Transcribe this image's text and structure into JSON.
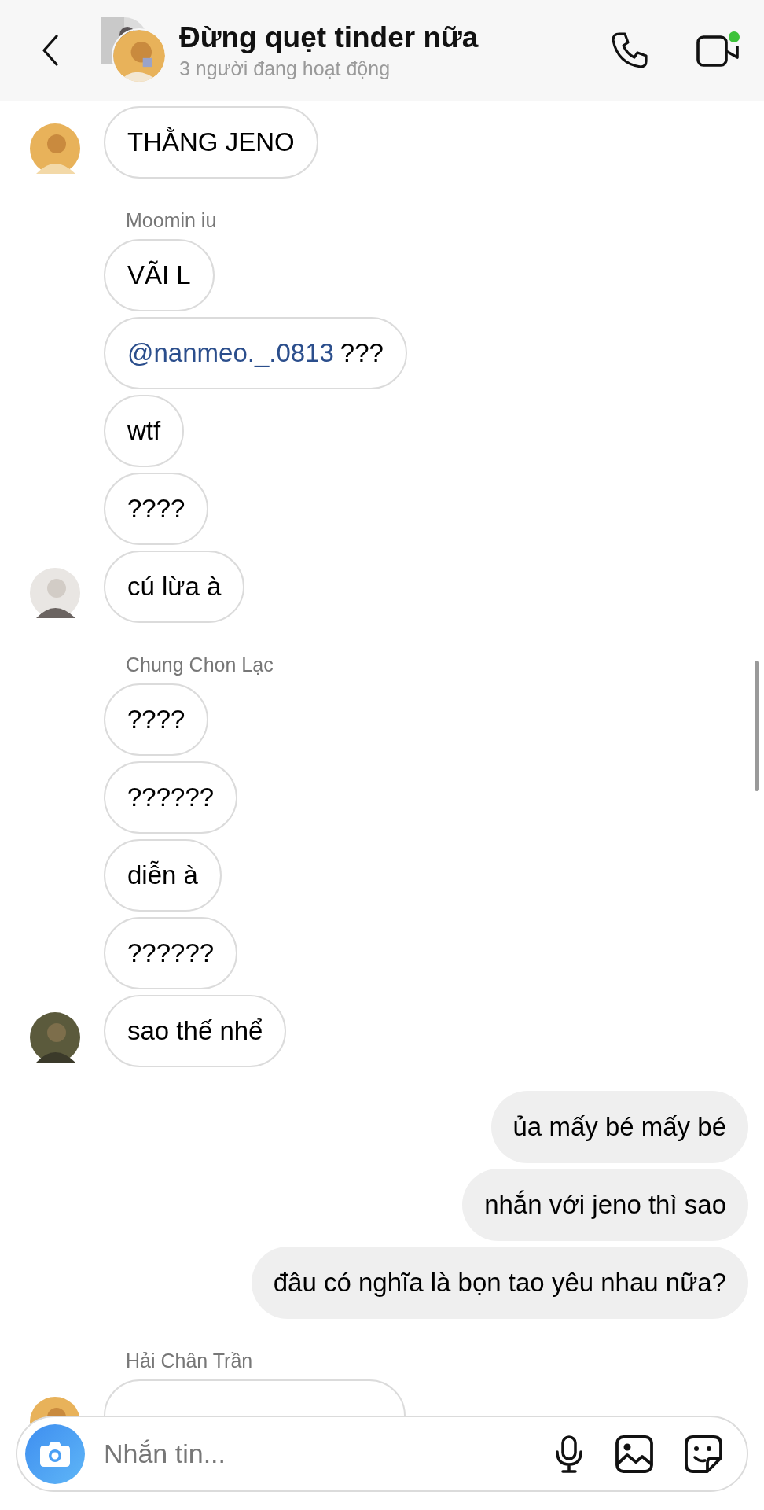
{
  "header": {
    "title": "Đừng quẹt tinder nữa",
    "subtitle": "3 người đang hoạt động",
    "video_active": true
  },
  "messages": [
    {
      "kind": "incoming",
      "text": "THẰNG JENO",
      "avatar": true
    },
    {
      "kind": "sender",
      "text": "Moomin iu"
    },
    {
      "kind": "incoming",
      "text": "VÃI L",
      "avatar": false
    },
    {
      "kind": "incoming",
      "mention": "@nanmeo._.0813",
      "text": "???",
      "avatar": false
    },
    {
      "kind": "incoming",
      "text": "wtf",
      "avatar": false
    },
    {
      "kind": "incoming",
      "text": "????",
      "avatar": false
    },
    {
      "kind": "incoming",
      "text": "cú lừa à",
      "avatar": true
    },
    {
      "kind": "sender",
      "text": "Chung Chon Lạc"
    },
    {
      "kind": "incoming",
      "text": "????",
      "avatar": false
    },
    {
      "kind": "incoming",
      "text": "??????",
      "avatar": false
    },
    {
      "kind": "incoming",
      "text": "diễn à",
      "avatar": false
    },
    {
      "kind": "incoming",
      "text": "??????",
      "avatar": false
    },
    {
      "kind": "incoming",
      "text": "sao thế nhể",
      "avatar": true
    },
    {
      "kind": "outgoing",
      "text": "ủa mấy bé mấy bé"
    },
    {
      "kind": "outgoing",
      "text": "nhắn với jeno thì sao"
    },
    {
      "kind": "outgoing",
      "text": "đâu có nghĩa là bọn tao yêu nhau nữa?"
    },
    {
      "kind": "sender",
      "text": "Hải Chân Trần"
    },
    {
      "kind": "partial",
      "avatar": true
    }
  ],
  "composer": {
    "placeholder": "Nhắn tin..."
  }
}
